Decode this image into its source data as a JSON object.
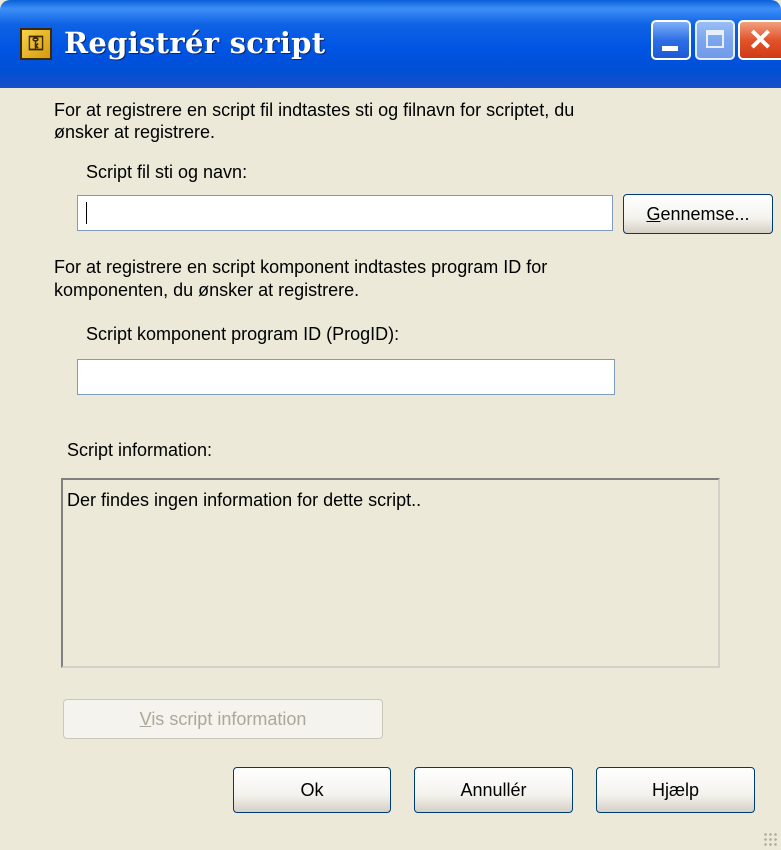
{
  "window": {
    "title": "Registrér script",
    "icon": "script-register-icon",
    "controls": {
      "minimize": "minimize-icon",
      "maximize": "maximize-icon",
      "close": "close-icon"
    },
    "colors": {
      "titlebar": "#0054e3",
      "face": "#ece9d8",
      "close": "#e2542b"
    }
  },
  "file_section": {
    "description_line1": "For at registrere en script fil indtastes sti og filnavn for scriptet, du",
    "description_line2": "ønsker at registrere.",
    "field_label": "Script fil sti og navn:",
    "field_value": "",
    "browse_label_accel": "G",
    "browse_label_rest": "ennemse..."
  },
  "component_section": {
    "description_line1": "For at registrere en script komponent indtastes program ID for",
    "description_line2": "komponenten, du ønsker at registrere.",
    "field_label": "Script komponent program ID (ProgID):",
    "field_value": ""
  },
  "info_section": {
    "label": "Script information:",
    "text": "Der findes ingen information for dette script..",
    "show_button_accel": "V",
    "show_button_rest": "is script information"
  },
  "buttons": {
    "ok": "Ok",
    "cancel": "Annullér",
    "help": "Hjælp"
  }
}
